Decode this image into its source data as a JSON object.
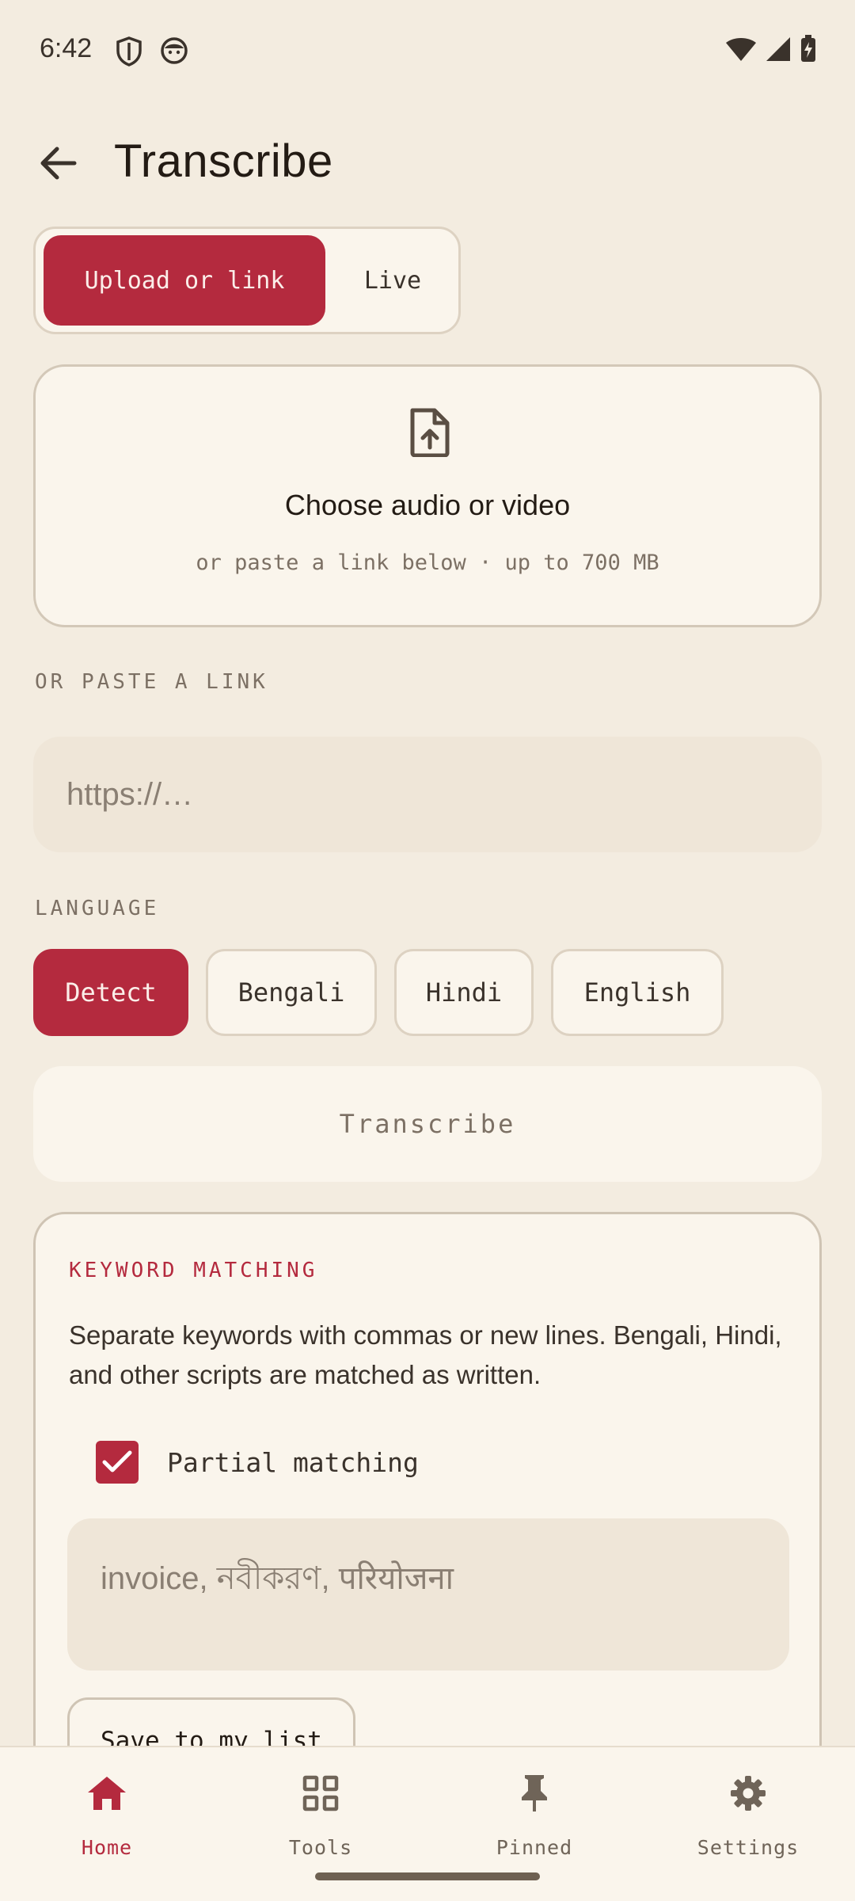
{
  "status_bar": {
    "time": "6:42"
  },
  "header": {
    "title": "Transcribe"
  },
  "mode_toggle": {
    "options": [
      "Upload or link",
      "Live"
    ],
    "selected": "Upload or link"
  },
  "upload": {
    "title": "Choose audio or video",
    "subtitle": "or paste a link below · up to 700 MB"
  },
  "link_section": {
    "label": "OR PASTE A LINK",
    "placeholder": "https://…",
    "value": ""
  },
  "language_section": {
    "label": "LANGUAGE",
    "options": [
      "Detect",
      "Bengali",
      "Hindi",
      "English"
    ],
    "selected": "Detect"
  },
  "transcribe_button": {
    "label": "Transcribe"
  },
  "keyword_matching": {
    "title": "KEYWORD MATCHING",
    "description": "Separate keywords with commas or new lines. Bengali, Hindi, and other scripts are matched as written.",
    "partial_matching": {
      "label": "Partial matching",
      "checked": true
    },
    "input_placeholder": "invoice, নবীকরণ, परियोजना",
    "save_label": "Save to my list"
  },
  "bottom_nav": {
    "items": [
      {
        "label": "Home",
        "icon": "home-icon",
        "active": true
      },
      {
        "label": "Tools",
        "icon": "grid-icon",
        "active": false
      },
      {
        "label": "Pinned",
        "icon": "pin-icon",
        "active": false
      },
      {
        "label": "Settings",
        "icon": "gear-icon",
        "active": false
      }
    ]
  },
  "colors": {
    "accent": "#b42a3e",
    "background": "#f3ece0",
    "surface": "#faf5ec"
  }
}
